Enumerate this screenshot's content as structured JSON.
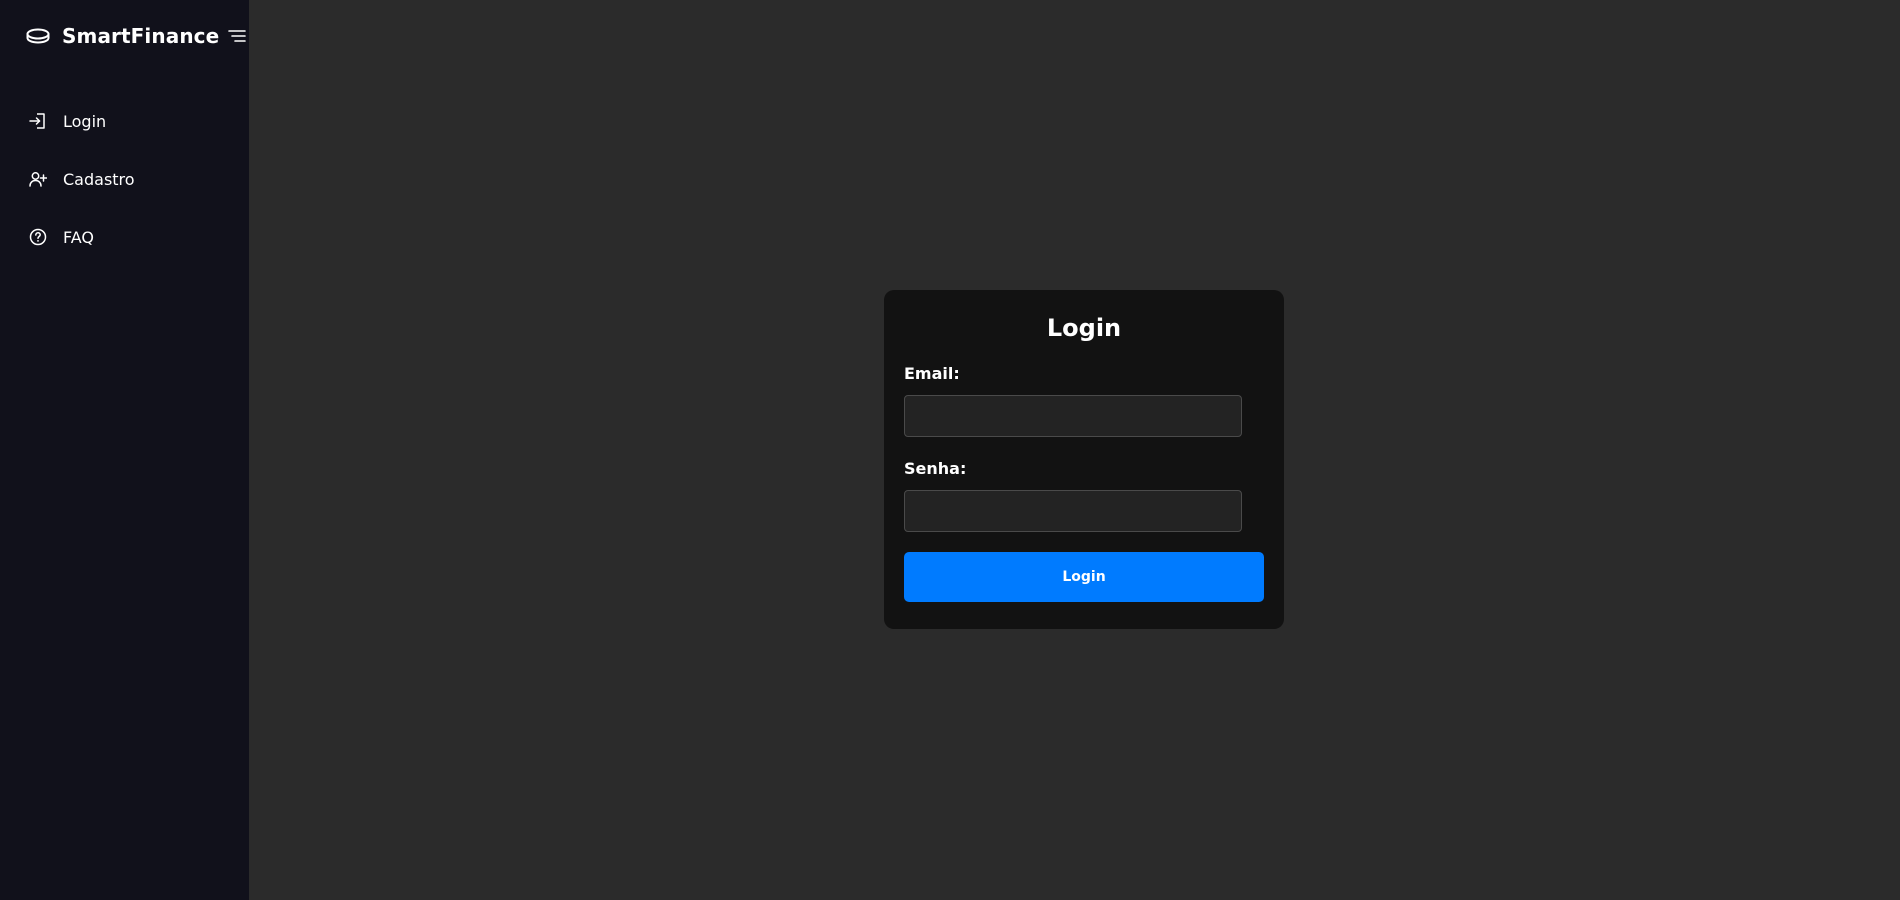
{
  "brand": {
    "name": "SmartFinance",
    "logo_icon": "coin-icon",
    "menu_icon": "menu-lines-icon"
  },
  "sidebar": {
    "items": [
      {
        "label": "Login",
        "icon": "login-icon"
      },
      {
        "label": "Cadastro",
        "icon": "user-plus-icon"
      },
      {
        "label": "FAQ",
        "icon": "help-circle-icon"
      }
    ]
  },
  "login_form": {
    "title": "Login",
    "email_label": "Email:",
    "email_value": "",
    "password_label": "Senha:",
    "password_value": "",
    "submit_label": "Login"
  },
  "colors": {
    "sidebar_bg": "#11111b",
    "main_bg": "#2b2b2b",
    "card_bg": "#121212",
    "input_bg": "#232323",
    "accent": "#007bff",
    "text": "#ffffff"
  }
}
